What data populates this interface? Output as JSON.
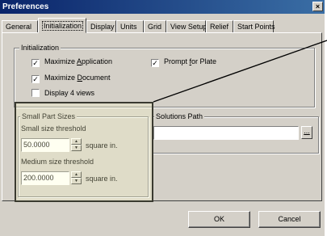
{
  "window": {
    "title": "Preferences",
    "close_glyph": "×"
  },
  "tabs": [
    {
      "label": "General"
    },
    {
      "label": "Initialization",
      "active": true
    },
    {
      "label": "Display"
    },
    {
      "label": "Units"
    },
    {
      "label": "Grid"
    },
    {
      "label": "View Setup"
    },
    {
      "label": "Relief"
    },
    {
      "label": "Start Points"
    }
  ],
  "initialization": {
    "group_label": "Initialization",
    "maximize_application": {
      "prefix": "Maximize ",
      "accel": "A",
      "suffix": "pplication",
      "checked": true
    },
    "maximize_document": {
      "prefix": "Maximize ",
      "accel": "D",
      "suffix": "ocument",
      "checked": true
    },
    "display_4_views": {
      "label": "Display 4 views",
      "checked": false
    },
    "prompt_for_plate": {
      "prefix": "Prompt ",
      "accel": "f",
      "suffix": "or Plate",
      "checked": true
    }
  },
  "small_part_sizes": {
    "group_label": "Small Part Sizes",
    "small_label": "Small size threshold",
    "small_value": "50.0000",
    "medium_label": "Medium size threshold",
    "medium_value": "200.0000",
    "unit": "square in."
  },
  "solutions_path": {
    "group_label": "Solutions Path",
    "value": "",
    "browse_label": "..."
  },
  "buttons": {
    "ok": "OK",
    "cancel": "Cancel"
  },
  "check_glyph": "✓"
}
